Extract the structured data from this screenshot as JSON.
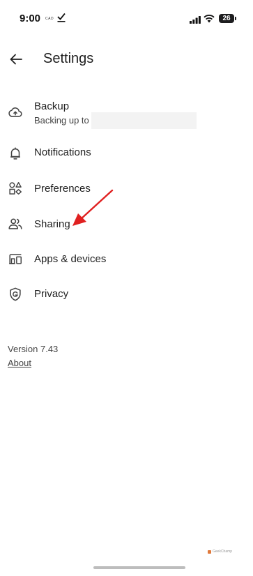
{
  "status_bar": {
    "time": "9:00",
    "small_text": "CAD",
    "battery": "26",
    "icons": [
      "check-icon",
      "signal-icon",
      "wifi-icon",
      "battery-icon"
    ]
  },
  "header": {
    "back_icon": "arrow-left-icon",
    "title": "Settings"
  },
  "menu": {
    "items": [
      {
        "id": "backup",
        "icon": "cloud-upload-icon",
        "label": "Backup",
        "sub": "Backing up to"
      },
      {
        "id": "notifications",
        "icon": "bell-icon",
        "label": "Notifications"
      },
      {
        "id": "preferences",
        "icon": "shapes-icon",
        "label": "Preferences"
      },
      {
        "id": "sharing",
        "icon": "people-icon",
        "label": "Sharing"
      },
      {
        "id": "apps-devices",
        "icon": "devices-icon",
        "label": "Apps & devices"
      },
      {
        "id": "privacy",
        "icon": "shield-g-icon",
        "label": "Privacy"
      }
    ]
  },
  "footer": {
    "version": "Version 7.43",
    "about": "About"
  },
  "watermark": "GeekChamp",
  "colors": {
    "annotation_arrow": "#e02020",
    "text": "#1f1f1f"
  }
}
